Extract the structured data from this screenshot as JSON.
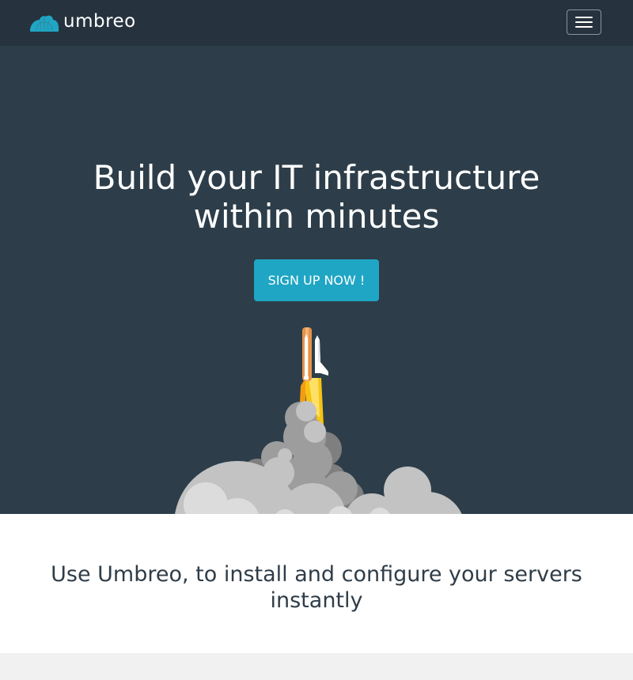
{
  "navbar": {
    "brand_name": "umbreo",
    "logo_icon": "umbrella-cloud-logo",
    "menu_icon": "hamburger-menu-icon",
    "background": "#26333e"
  },
  "hero": {
    "title_line1": "Build your IT infrastructure",
    "title_line2": "within minutes",
    "cta_label": "SIGN UP NOW !",
    "cta_color": "#1fa6c4",
    "background": "#2d3e4a",
    "illustration": "rocket-launch-illustration"
  },
  "tagline": {
    "text": "Use Umbreo, to install and configure your servers instantly"
  }
}
